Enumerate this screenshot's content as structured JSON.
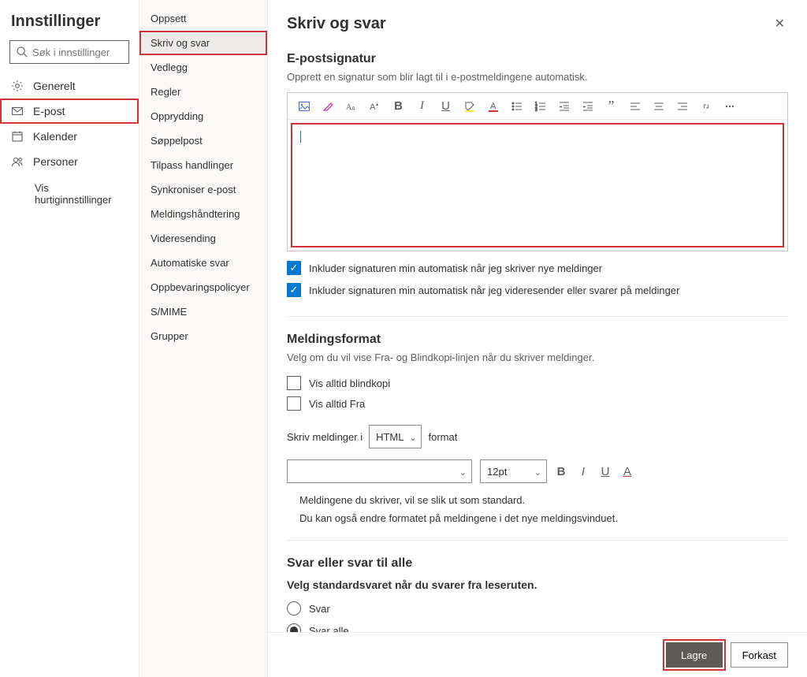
{
  "header": {
    "title": "Innstillinger"
  },
  "search": {
    "placeholder": "Søk i innstillinger"
  },
  "nav1": {
    "items": [
      {
        "label": "Generelt",
        "icon": "gear"
      },
      {
        "label": "E-post",
        "icon": "mail",
        "selected": true,
        "highlight": true
      },
      {
        "label": "Kalender",
        "icon": "calendar"
      },
      {
        "label": "Personer",
        "icon": "people"
      }
    ],
    "footer": "Vis hurtiginnstillinger"
  },
  "nav2": {
    "items": [
      "Oppsett",
      "Skriv og svar",
      "Vedlegg",
      "Regler",
      "Opprydding",
      "Søppelpost",
      "Tilpass handlinger",
      "Synkroniser e-post",
      "Meldingshåndtering",
      "Videresending",
      "Automatiske svar",
      "Oppbevaringspolicyer",
      "S/MIME",
      "Grupper"
    ],
    "selected_index": 1
  },
  "main": {
    "title": "Skriv og svar",
    "signature": {
      "heading": "E-postsignatur",
      "desc": "Opprett en signatur som blir lagt til i e-postmeldingene automatisk.",
      "check1": "Inkluder signaturen min automatisk når jeg skriver nye meldinger",
      "check2": "Inkluder signaturen min automatisk når jeg videresender eller svarer på meldinger"
    },
    "format": {
      "heading": "Meldingsformat",
      "desc": "Velg om du vil vise Fra- og Blindkopi-linjen når du skriver meldinger.",
      "bcc_label": "Vis alltid blindkopi",
      "from_label": "Vis alltid Fra",
      "compose_pre": "Skriv meldinger i",
      "compose_value": "HTML",
      "compose_post": "format",
      "font_size_value": "12pt",
      "info1": "Meldingene du skriver, vil se slik ut som standard.",
      "info2": "Du kan også endre formatet på meldingene i det nye meldingsvinduet."
    },
    "reply": {
      "heading": "Svar eller svar til alle",
      "desc": "Velg standardsvaret når du svarer fra leseruten.",
      "opt1": "Svar",
      "opt2": "Svar alle"
    }
  },
  "footer": {
    "save": "Lagre",
    "discard": "Forkast"
  }
}
